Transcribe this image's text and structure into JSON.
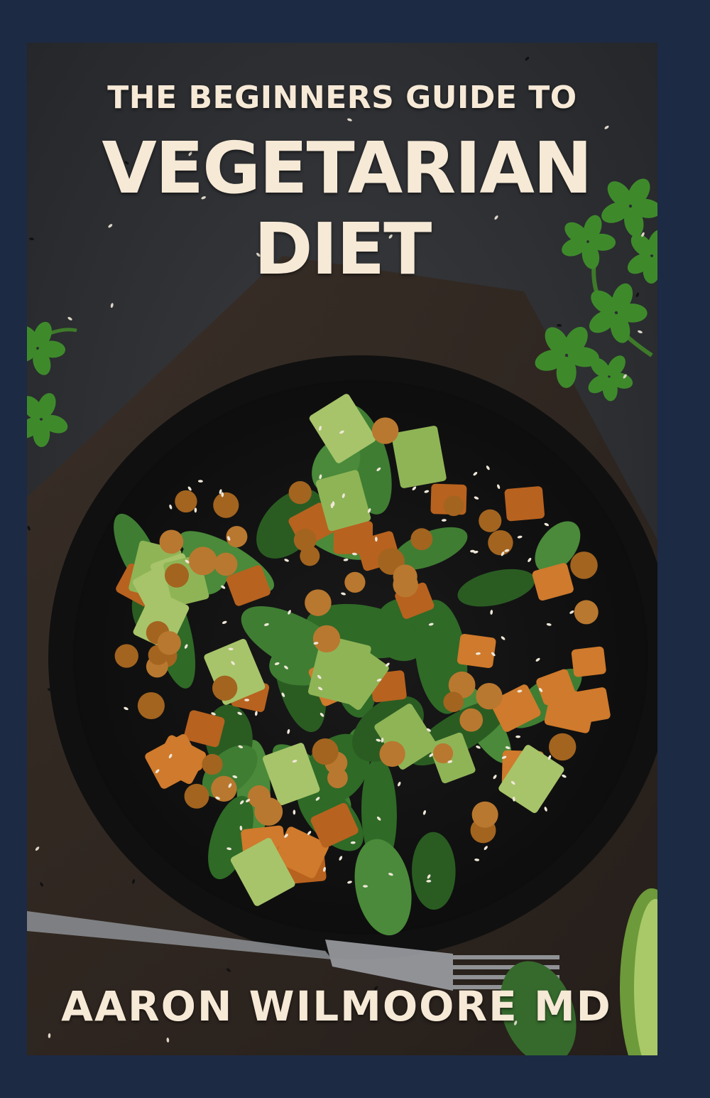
{
  "cover": {
    "subtitle": "THE BEGINNERS GUIDE TO",
    "title_line_1": "VEGETARIAN",
    "title_line_2": "DIET",
    "author": "AARON WILMOORE MD"
  },
  "colors": {
    "frame": "#1c2a44",
    "background": "#2b2d30",
    "title_text": "#f6e9d6",
    "spinach": "#3f7d33",
    "avocado": "#a7c46a",
    "sweet_potato": "#cf7a2c",
    "chickpea": "#b9782f",
    "parsley": "#3e8a2b"
  },
  "image": {
    "subject": "salad bowl with spinach, avocado, roasted sweet potato and chickpeas on a dark surface"
  }
}
